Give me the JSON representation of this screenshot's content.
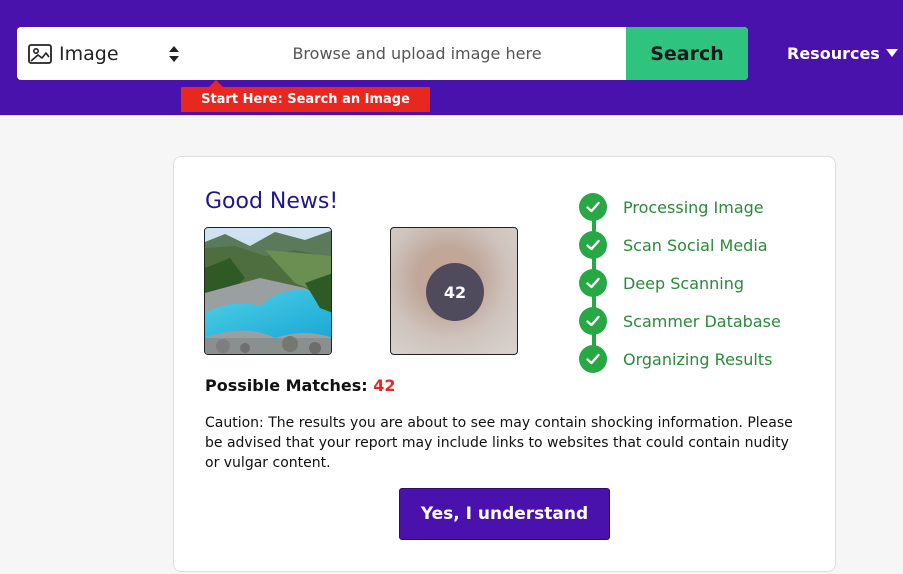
{
  "header": {
    "type_select": {
      "icon": "image-icon",
      "label": "Image"
    },
    "search": {
      "placeholder": "Browse and upload image here",
      "value": ""
    },
    "search_button_label": "Search",
    "hint": "Start Here: Search an Image",
    "resources_label": "Resources"
  },
  "card": {
    "heading": "Good News!",
    "blur_count": "42",
    "matches_label": "Possible Matches:",
    "matches_count": "42",
    "caution": "Caution: The results you are about to see may contain shocking information. Please be advised that your report may include links to websites that could contain nudity or vulgar content.",
    "confirm_button_label": "Yes, I understand",
    "steps": [
      {
        "label": "Processing Image",
        "done": true
      },
      {
        "label": "Scan Social Media",
        "done": true
      },
      {
        "label": "Deep Scanning",
        "done": true
      },
      {
        "label": "Scammer Database",
        "done": true
      },
      {
        "label": "Organizing Results",
        "done": true
      }
    ]
  },
  "colors": {
    "brand": "#4a12ad",
    "search_button": "#2ec47f",
    "hint": "#e8271f",
    "step_green": "#28a745"
  }
}
